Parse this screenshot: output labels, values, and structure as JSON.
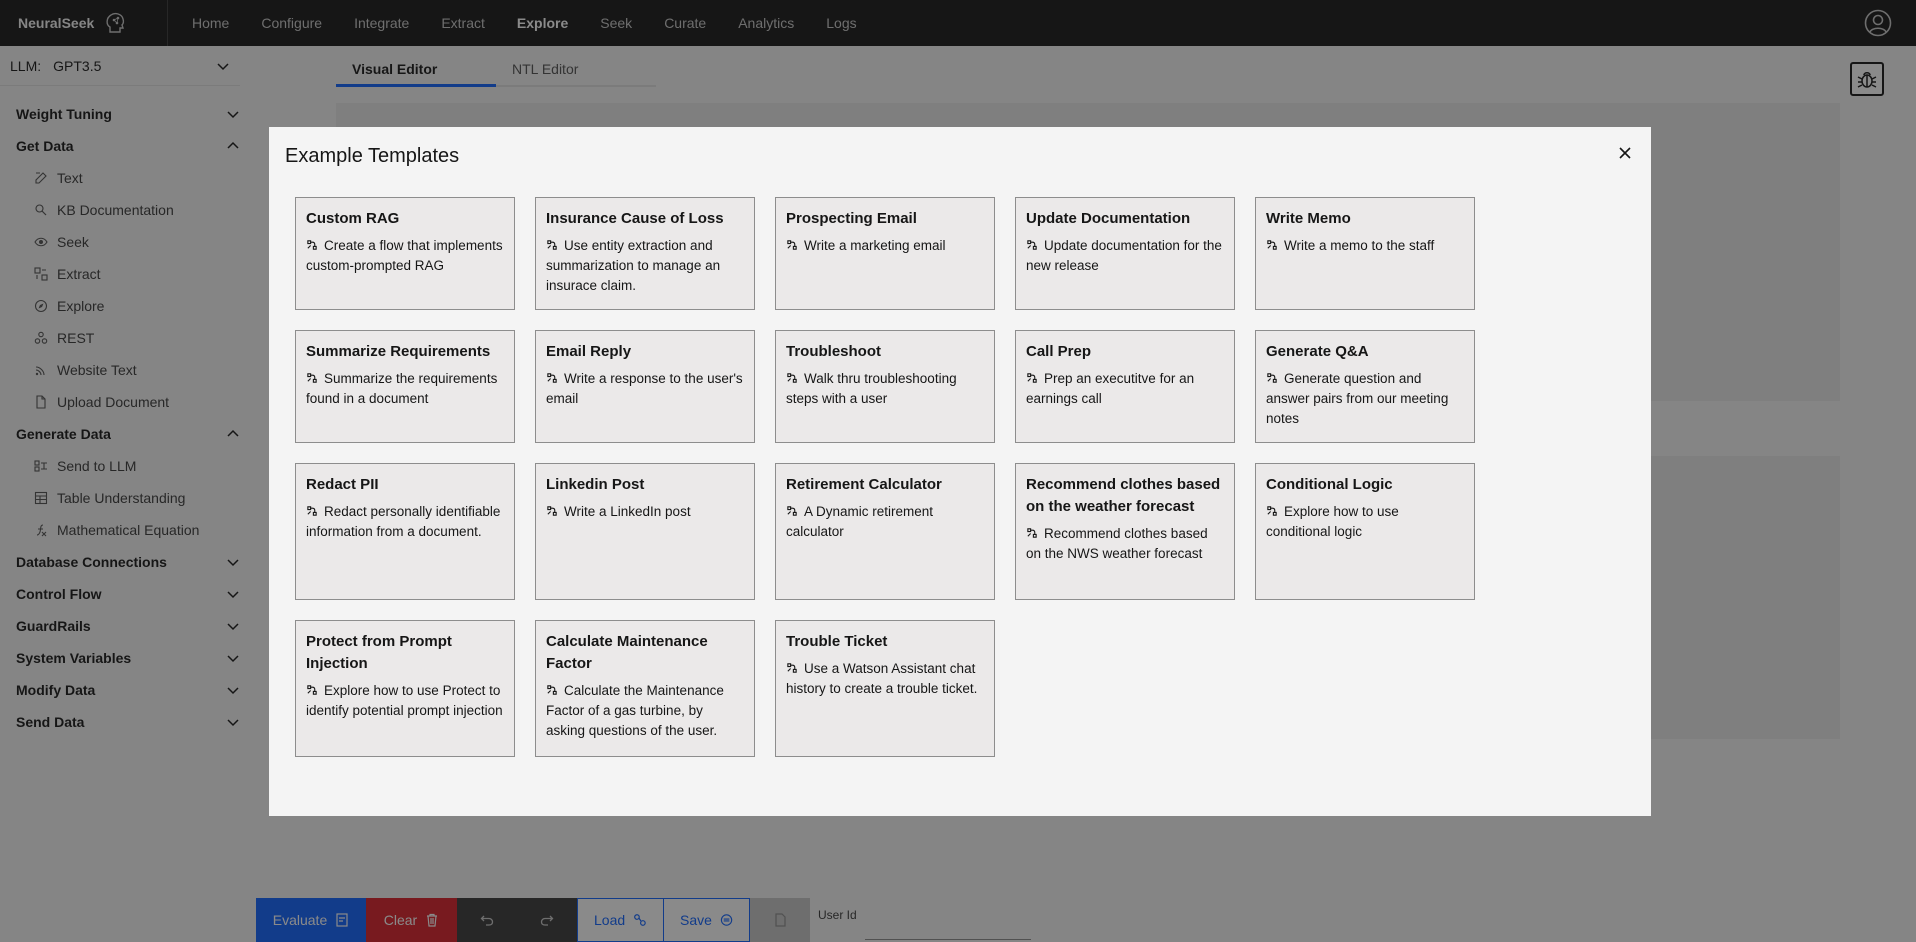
{
  "nav": {
    "brand": "NeuralSeek",
    "items": [
      "Home",
      "Configure",
      "Integrate",
      "Extract",
      "Explore",
      "Seek",
      "Curate",
      "Analytics",
      "Logs"
    ],
    "active": "Explore"
  },
  "sidebar": {
    "llm_label": "LLM:",
    "llm_value": "GPT3.5",
    "sections": [
      {
        "label": "Weight Tuning",
        "expanded": false,
        "items": []
      },
      {
        "label": "Get Data",
        "expanded": true,
        "items": [
          {
            "label": "Text",
            "icon": "edit-icon"
          },
          {
            "label": "KB Documentation",
            "icon": "search-doc-icon"
          },
          {
            "label": "Seek",
            "icon": "eye-icon"
          },
          {
            "label": "Extract",
            "icon": "extract-icon"
          },
          {
            "label": "Explore",
            "icon": "compass-icon"
          },
          {
            "label": "REST",
            "icon": "rest-icon"
          },
          {
            "label": "Website Text",
            "icon": "wifi-icon"
          },
          {
            "label": "Upload Document",
            "icon": "document-icon"
          }
        ]
      },
      {
        "label": "Generate Data",
        "expanded": true,
        "items": [
          {
            "label": "Send to LLM",
            "icon": "llm-icon"
          },
          {
            "label": "Table Understanding",
            "icon": "table-icon"
          },
          {
            "label": "Mathematical Equation",
            "icon": "function-icon"
          }
        ]
      },
      {
        "label": "Database Connections",
        "expanded": false,
        "items": []
      },
      {
        "label": "Control Flow",
        "expanded": false,
        "items": []
      },
      {
        "label": "GuardRails",
        "expanded": false,
        "items": []
      },
      {
        "label": "System Variables",
        "expanded": false,
        "items": []
      },
      {
        "label": "Modify Data",
        "expanded": false,
        "items": []
      },
      {
        "label": "Send Data",
        "expanded": false,
        "items": []
      }
    ]
  },
  "tabs": [
    "Visual Editor",
    "NTL Editor"
  ],
  "active_tab": "Visual Editor",
  "bottom": {
    "evaluate": "Evaluate",
    "clear": "Clear",
    "load": "Load",
    "save": "Save",
    "user_id_label": "User Id",
    "user_id_value": ""
  },
  "modal": {
    "title": "Example Templates",
    "templates": [
      {
        "title": "Custom RAG",
        "desc": "Create a flow that implements custom-prompted RAG"
      },
      {
        "title": "Insurance Cause of Loss",
        "desc": "Use entity extraction and summarization to manage an insurace claim."
      },
      {
        "title": "Prospecting Email",
        "desc": "Write a marketing email"
      },
      {
        "title": "Update Documentation",
        "desc": "Update documentation for the new release"
      },
      {
        "title": "Write Memo",
        "desc": "Write a memo to the staff"
      },
      {
        "title": "Summarize Requirements",
        "desc": "Summarize the requirements found in a document"
      },
      {
        "title": "Email Reply",
        "desc": "Write a response to the user's email"
      },
      {
        "title": "Troubleshoot",
        "desc": "Walk thru troubleshooting steps with a user"
      },
      {
        "title": "Call Prep",
        "desc": "Prep an executitve for an earnings call"
      },
      {
        "title": "Generate Q&A",
        "desc": "Generate question and answer pairs from our meeting notes"
      },
      {
        "title": "Redact PII",
        "desc": "Redact personally identifiable information from a document."
      },
      {
        "title": "Linkedin Post",
        "desc": "Write a LinkedIn post"
      },
      {
        "title": "Retirement Calculator",
        "desc": "A Dynamic retirement calculator"
      },
      {
        "title": "Recommend clothes based on the weather forecast",
        "desc": "Recommend clothes based on the NWS weather forecast"
      },
      {
        "title": "Conditional Logic",
        "desc": "Explore how to use conditional logic"
      },
      {
        "title": "Protect from Prompt Injection",
        "desc": "Explore how to use Protect to identify potential prompt injection"
      },
      {
        "title": "Calculate Maintenance Factor",
        "desc": "Calculate the Maintenance Factor of a gas turbine, by asking questions of the user."
      },
      {
        "title": "Trouble Ticket",
        "desc": "Use a Watson Assistant chat history to create a trouble ticket."
      }
    ]
  }
}
